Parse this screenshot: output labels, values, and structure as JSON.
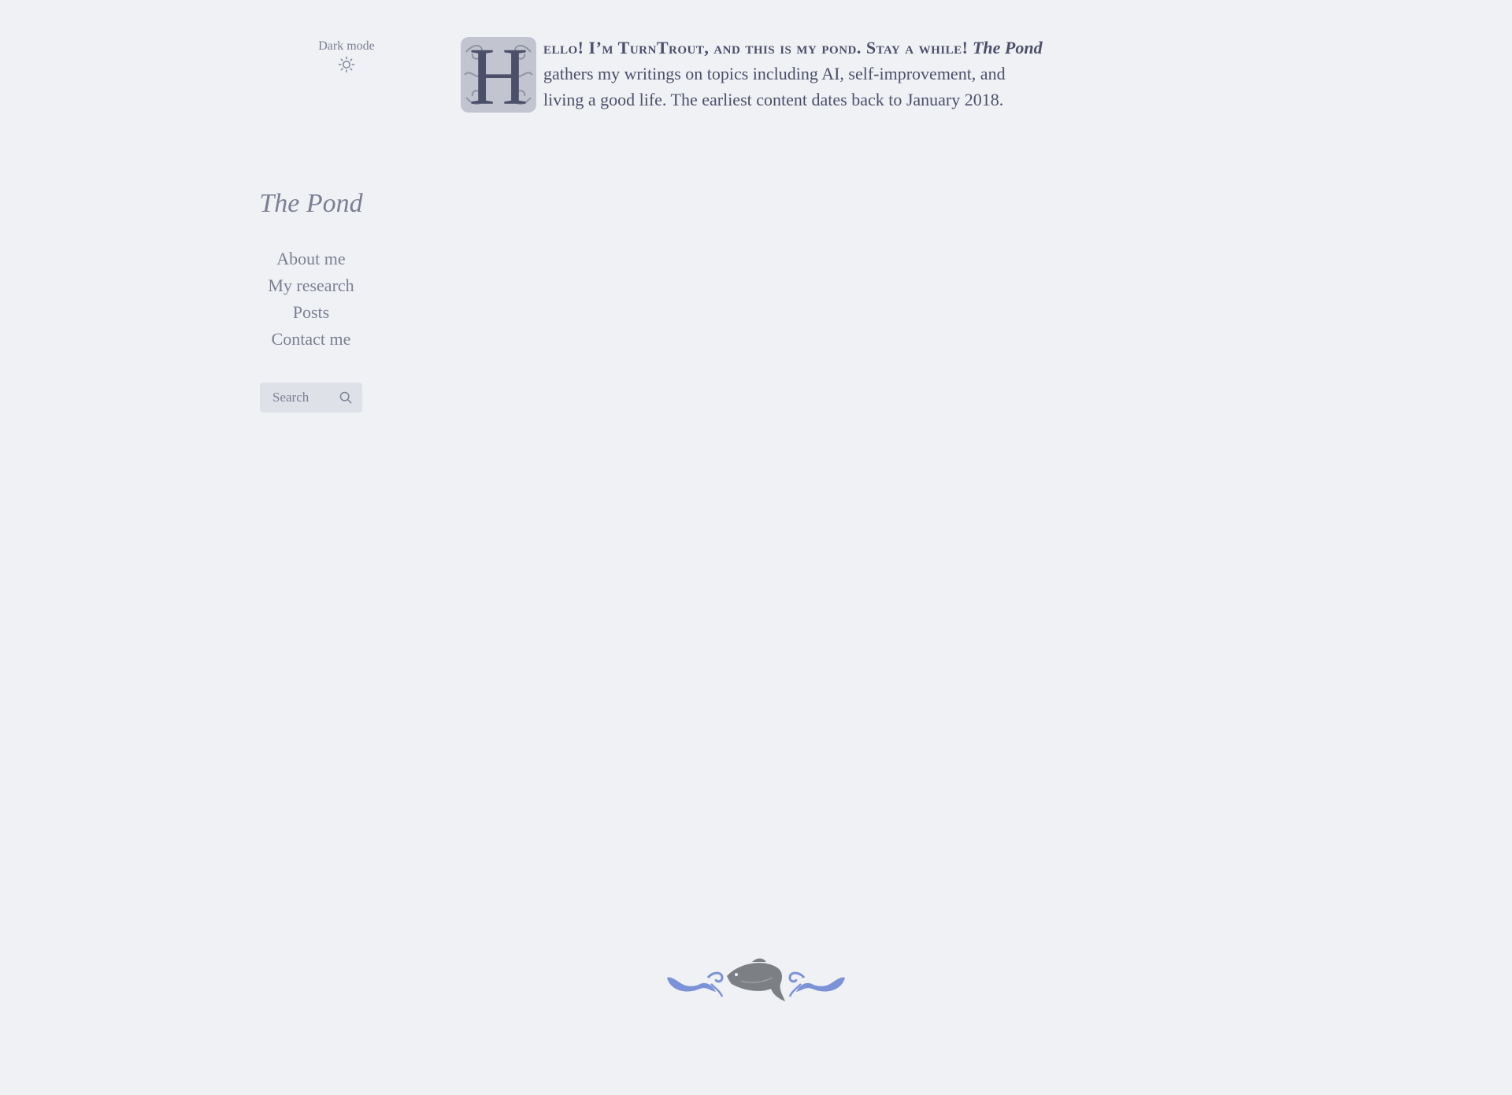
{
  "theme_toggle": {
    "label": "Dark mode",
    "icon": "sun-icon"
  },
  "sidebar": {
    "title": "The Pond",
    "nav": [
      {
        "label": "About me"
      },
      {
        "label": "My research"
      },
      {
        "label": "Posts"
      },
      {
        "label": "Contact me"
      }
    ],
    "search": {
      "placeholder": "Search",
      "icon": "search-icon"
    }
  },
  "intro": {
    "drop_cap": "H",
    "lead_smallcaps": "ello! I’m TurnTrout, and this is my pond. Stay a while!",
    "italic_title": "The Pond",
    "rest": "gathers my writings on topics including AI, self-improvement, and living a good life. The earliest content dates back to January 2018."
  },
  "footer": {
    "ornament_icon": "trout-ornament-icon"
  },
  "colors": {
    "background": "#eff1f5",
    "text": "#4c4f69",
    "muted": "#7c7f93",
    "accent": "#7287fd",
    "ornament_fish": "#7c7f84",
    "search_bg": "#dfe1e8"
  }
}
